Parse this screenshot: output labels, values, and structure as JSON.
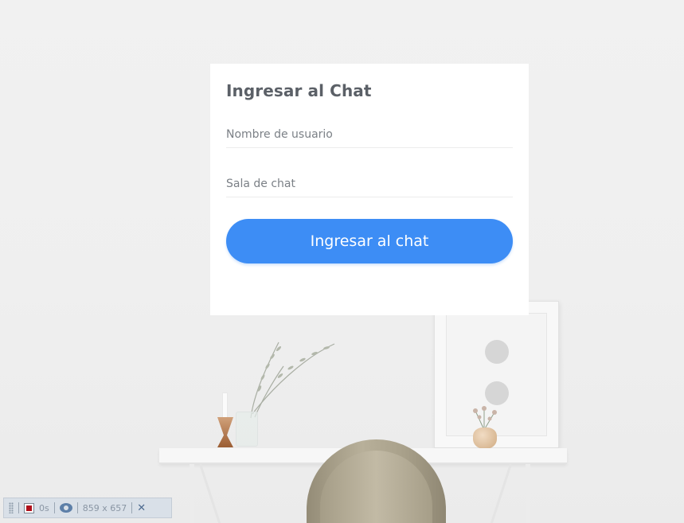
{
  "login": {
    "title": "Ingresar al Chat",
    "username_placeholder": "Nombre de usuario",
    "username_value": "",
    "room_placeholder": "Sala de chat",
    "room_value": "",
    "submit_label": "Ingresar al chat"
  },
  "toolbar": {
    "timer": "0s",
    "dimensions": "859 x 657",
    "close": "✕",
    "icons": [
      "grip-icon",
      "record-stop-icon",
      "eye-icon",
      "close-icon"
    ]
  },
  "colors": {
    "accent": "#3d8df5",
    "card_background": "#ffffff",
    "page_background": "#efefef",
    "title_text": "#5b6067",
    "toolbar_background": "#d9e0e8"
  }
}
